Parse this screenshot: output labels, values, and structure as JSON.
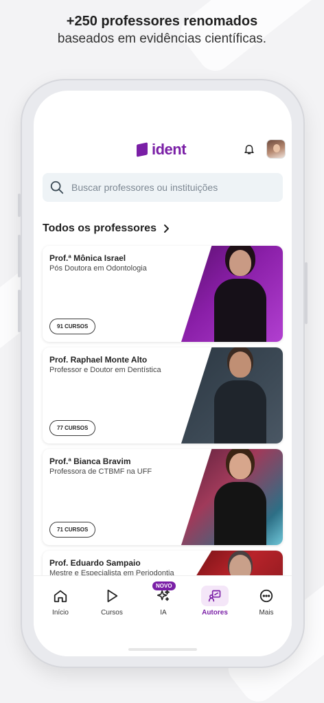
{
  "headline": {
    "line1": "+250 professores renomados",
    "line2": "baseados em evidências científicas."
  },
  "app": {
    "brand": "ident",
    "brand_color": "#7a1fa6",
    "icons": {
      "notifications": "bell-icon",
      "profile": "avatar"
    }
  },
  "search": {
    "placeholder": "Buscar professores ou instituições",
    "value": ""
  },
  "section": {
    "title": "Todos os professores"
  },
  "professors": [
    {
      "name": "Prof.ª Mônica Israel",
      "title": "Pós Doutora em Odontologia",
      "courses": "91 CURSOS"
    },
    {
      "name": "Prof. Raphael Monte Alto",
      "title": "Professor e Doutor em Dentística",
      "courses": "77 CURSOS"
    },
    {
      "name": "Prof.ª Bianca Bravim",
      "title": "Professora de CTBMF na UFF",
      "courses": "71 CURSOS"
    },
    {
      "name": "Prof. Eduardo Sampaio",
      "title": "Mestre e Especialista em Periodontia",
      "courses": ""
    }
  ],
  "tabs": [
    {
      "label": "Início",
      "icon": "home-icon"
    },
    {
      "label": "Cursos",
      "icon": "play-icon"
    },
    {
      "label": "IA",
      "icon": "sparkles-icon",
      "badge": "NOVO"
    },
    {
      "label": "Autores",
      "icon": "presenter-icon",
      "active": true
    },
    {
      "label": "Mais",
      "icon": "more-icon"
    }
  ]
}
